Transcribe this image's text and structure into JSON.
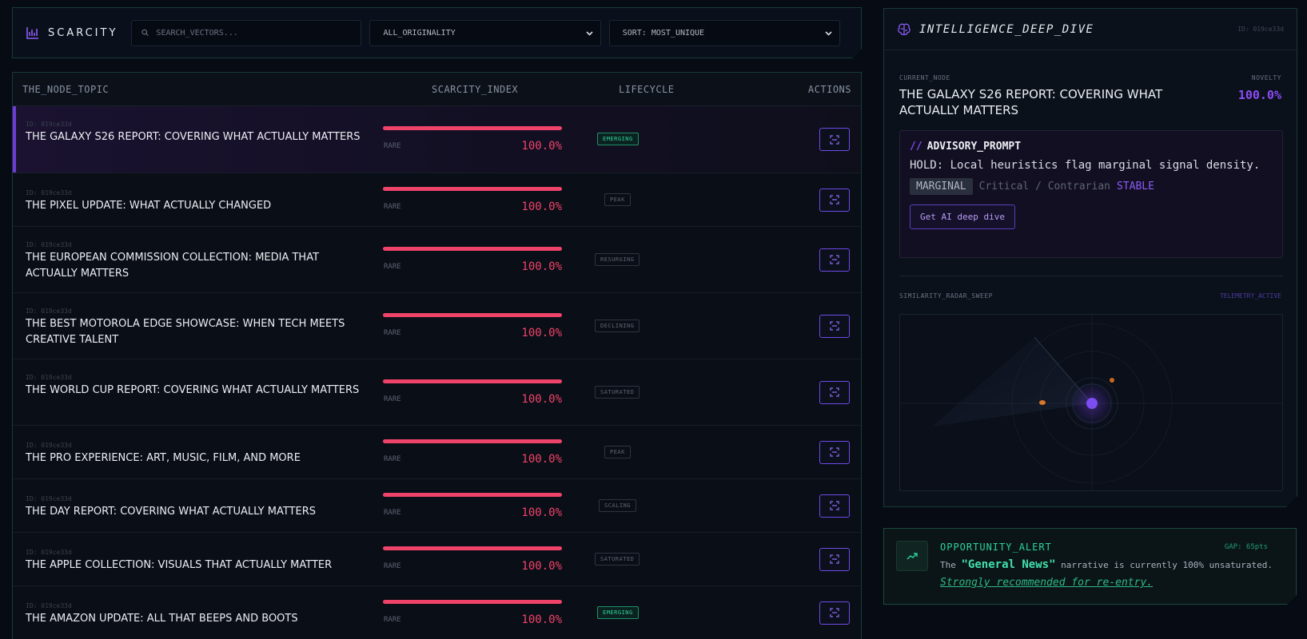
{
  "toolbar": {
    "brand": "SCARCITY",
    "search_placeholder": "SEARCH_VECTORS...",
    "filter_value": "ALL_ORIGINALITY",
    "sort_value": "SORT: MOST_UNIQUE"
  },
  "table": {
    "headers": {
      "topic": "THE_NODE_TOPIC",
      "scarcity": "SCARCITY_INDEX",
      "lifecycle": "LIFECYCLE",
      "actions": "ACTIONS"
    },
    "rows": [
      {
        "id": "ID: 019ce33d",
        "title": "THE GALAXY S26 REPORT: COVERING WHAT ACTUALLY MATTERS",
        "rarity": "RARE",
        "score": "100.0%",
        "lifecycle": "EMERGING"
      },
      {
        "id": "ID: 019ce33d",
        "title": "THE PIXEL UPDATE: WHAT ACTUALLY CHANGED",
        "rarity": "RARE",
        "score": "100.0%",
        "lifecycle": "PEAK"
      },
      {
        "id": "ID: 019ce33d",
        "title": "THE EUROPEAN COMMISSION COLLECTION: MEDIA THAT ACTUALLY MATTERS",
        "rarity": "RARE",
        "score": "100.0%",
        "lifecycle": "RESURGING"
      },
      {
        "id": "ID: 019ce33d",
        "title": "THE BEST MOTOROLA EDGE SHOWCASE: WHEN TECH MEETS CREATIVE TALENT",
        "rarity": "RARE",
        "score": "100.0%",
        "lifecycle": "DECLINING"
      },
      {
        "id": "ID: 019ce33d",
        "title": "THE WORLD CUP REPORT: COVERING WHAT ACTUALLY MATTERS",
        "rarity": "RARE",
        "score": "100.0%",
        "lifecycle": "SATURATED"
      },
      {
        "id": "ID: 019ce33d",
        "title": "THE PRO EXPERIENCE: ART, MUSIC, FILM, AND MORE",
        "rarity": "RARE",
        "score": "100.0%",
        "lifecycle": "PEAK"
      },
      {
        "id": "ID: 019ce33d",
        "title": "THE DAY REPORT: COVERING WHAT ACTUALLY MATTERS",
        "rarity": "RARE",
        "score": "100.0%",
        "lifecycle": "SCALING"
      },
      {
        "id": "ID: 019ce33d",
        "title": "THE APPLE COLLECTION: VISUALS THAT ACTUALLY MATTER",
        "rarity": "RARE",
        "score": "100.0%",
        "lifecycle": "SATURATED"
      },
      {
        "id": "ID: 019ce33d",
        "title": "THE AMAZON UPDATE: ALL THAT BEEPS AND BOOTS",
        "rarity": "RARE",
        "score": "100.0%",
        "lifecycle": "EMERGING"
      }
    ]
  },
  "panel": {
    "title": "INTELLIGENCE_DEEP_DIVE",
    "id": "ID: 019ce33d",
    "current_node_label": "CURRENT_NODE",
    "novelty_label": "NOVELTY",
    "current_node_title": "THE GALAXY S26 REPORT: COVERING WHAT ACTUALLY MATTERS",
    "novelty_value": "100.0%",
    "advisory": {
      "slashes": "//",
      "title": "ADVISORY_PROMPT",
      "text": "HOLD: Local heuristics flag marginal signal density.",
      "tag_marginal": "MARGINAL",
      "tag_critical": "Critical / Contrarian",
      "tag_stable": "STABLE",
      "button": "Get AI deep dive"
    },
    "radar_label": "SIMILARITY_RADAR_SWEEP",
    "radar_status": "TELEMETRY_ACTIVE"
  },
  "opportunity": {
    "title": "OPPORTUNITY_ALERT",
    "gap": "GAP: 65pts",
    "text_pre": "The",
    "highlight": "\"General News\"",
    "text_post": "narrative is currently 100% unsaturated.",
    "cta": "Strongly recommended for re-entry."
  },
  "colors": {
    "accent": "#8b4cf6",
    "danger": "#f0436a",
    "success": "#2bd39a",
    "border": "#173a37"
  },
  "icons": {
    "brand": "bar-chart-icon",
    "search": "search-icon",
    "dropdown": "chevron-down-icon",
    "action": "scan-icon",
    "panel": "brain-icon",
    "opportunity": "trending-up-icon"
  }
}
